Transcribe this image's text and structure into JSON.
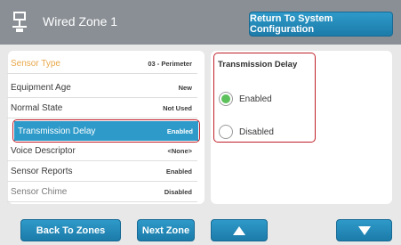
{
  "header": {
    "title": "Wired Zone 1",
    "return_label": "Return To System Configuration"
  },
  "list": {
    "rows": [
      {
        "label": "Sensor Type",
        "value": "03 - Perimeter"
      },
      {
        "label": "Equipment Age",
        "value": "New"
      },
      {
        "label": "Normal State",
        "value": "Not Used"
      },
      {
        "label": "Transmission Delay",
        "value": "Enabled"
      },
      {
        "label": "Voice Descriptor",
        "value": "<None>"
      },
      {
        "label": "Sensor Reports",
        "value": "Enabled"
      },
      {
        "label": "Sensor Chime",
        "value": "Disabled"
      }
    ]
  },
  "options": {
    "title": "Transmission Delay",
    "items": [
      {
        "label": "Enabled",
        "selected": true
      },
      {
        "label": "Disabled",
        "selected": false
      }
    ]
  },
  "footer": {
    "back_label": "Back To Zones",
    "next_label": "Next Zone"
  },
  "colors": {
    "header_bg": "#8a8f95",
    "accent": "#2e9ac9",
    "highlight_outline": "#c0202a",
    "radio_selected": "#5cc15a"
  }
}
